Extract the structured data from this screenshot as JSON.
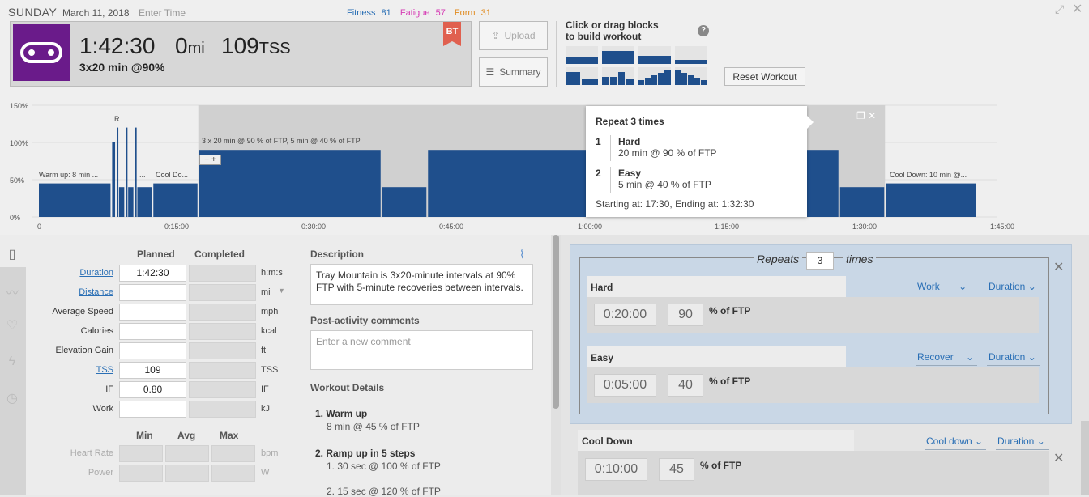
{
  "header": {
    "day": "SUNDAY",
    "date": "March 11, 2018",
    "time_placeholder": "Enter Time",
    "fitness_label": "Fitness",
    "fitness": "81",
    "fatigue_label": "Fatigue",
    "fatigue": "57",
    "form_label": "Form",
    "form": "31"
  },
  "workout": {
    "duration": "1:42:30",
    "distance_num": "0",
    "distance_unit": "mi",
    "tss_num": "109",
    "tss_unit": "TSS",
    "title": "3x20 min @90%",
    "badge": "BT"
  },
  "buttons": {
    "upload": "Upload",
    "summary": "Summary",
    "reset": "Reset Workout"
  },
  "builder": {
    "line1": "Click or drag blocks",
    "line2": "to build workout",
    "help": "?"
  },
  "chart": {
    "y_ticks": [
      "150%",
      "100%",
      "50%",
      "0%"
    ],
    "x_ticks": [
      "0",
      "0:15:00",
      "0:30:00",
      "0:45:00",
      "1:00:00",
      "1:15:00",
      "1:30:00",
      "1:45:00"
    ],
    "labels": {
      "warmup": "Warm up: 8 min ...",
      "ramp": "R...",
      "dots": "...",
      "cooldown1": "Cool Do...",
      "repeat": "3 x 20 min @ 90 % of FTP, 5 min @ 40 % of FTP",
      "cooldown2": "Cool Down: 10 min @..."
    }
  },
  "chart_data": {
    "type": "bar",
    "xlabel": "",
    "ylabel": "",
    "ylim": [
      0,
      150
    ],
    "x_unit": "elapsed time",
    "segments": [
      {
        "start": "0:00:00",
        "end": "0:08:00",
        "pct": 45
      },
      {
        "start": "0:08:00",
        "end": "0:08:30",
        "pct": 100
      },
      {
        "start": "0:08:30",
        "end": "0:08:45",
        "pct": 120
      },
      {
        "start": "0:08:45",
        "end": "0:09:30",
        "pct": 40
      },
      {
        "start": "0:09:30",
        "end": "0:09:45",
        "pct": 120
      },
      {
        "start": "0:09:45",
        "end": "0:10:30",
        "pct": 40
      },
      {
        "start": "0:10:30",
        "end": "0:10:45",
        "pct": 120
      },
      {
        "start": "0:10:45",
        "end": "0:12:30",
        "pct": 40
      },
      {
        "start": "0:12:30",
        "end": "0:17:30",
        "pct": 45
      },
      {
        "start": "0:17:30",
        "end": "0:37:30",
        "pct": 90
      },
      {
        "start": "0:37:30",
        "end": "0:42:30",
        "pct": 40
      },
      {
        "start": "0:42:30",
        "end": "1:02:30",
        "pct": 90
      },
      {
        "start": "1:02:30",
        "end": "1:07:30",
        "pct": 40
      },
      {
        "start": "1:07:30",
        "end": "1:27:30",
        "pct": 90
      },
      {
        "start": "1:27:30",
        "end": "1:32:30",
        "pct": 40
      },
      {
        "start": "1:32:30",
        "end": "1:42:30",
        "pct": 45
      }
    ]
  },
  "popup": {
    "title": "Repeat 3 times",
    "step1_num": "1",
    "step1_name": "Hard",
    "step1_desc": "20 min @ 90 % of FTP",
    "step2_num": "2",
    "step2_name": "Easy",
    "step2_desc": "5 min @ 40 % of FTP",
    "footer": "Starting at: 17:30, Ending at: 1:32:30"
  },
  "stats": {
    "planned": "Planned",
    "completed": "Completed",
    "rows": [
      {
        "label": "Duration",
        "planned": "1:42:30",
        "unit": "h:m:s"
      },
      {
        "label": "Distance",
        "planned": "",
        "unit": "mi"
      },
      {
        "label": "Average Speed",
        "planned": "",
        "unit": "mph"
      },
      {
        "label": "Calories",
        "planned": "",
        "unit": "kcal"
      },
      {
        "label": "Elevation Gain",
        "planned": "",
        "unit": "ft"
      },
      {
        "label": "TSS",
        "planned": "109",
        "unit": "TSS"
      },
      {
        "label": "IF",
        "planned": "0.80",
        "unit": "IF"
      },
      {
        "label": "Work",
        "planned": "",
        "unit": "kJ"
      }
    ],
    "min": "Min",
    "avg": "Avg",
    "max": "Max",
    "hr_label": "Heart Rate",
    "hr_unit": "bpm",
    "power_label": "Power",
    "power_unit": "W"
  },
  "description": {
    "heading": "Description",
    "text": "Tray Mountain is 3x20-minute intervals at 90% FTP with 5-minute recoveries between intervals.",
    "comments_heading": "Post-activity comments",
    "comments_placeholder": "Enter a new comment",
    "details_heading": "Workout Details",
    "step1": "1.  Warm up",
    "step1_sub": "8 min @ 45 % of FTP",
    "step2": "2.  Ramp up in 5 steps",
    "step2_sub1": "1.  30 sec @ 100 % of FTP",
    "step2_sub2": "2.  15 sec @ 120 % of FTP"
  },
  "editor": {
    "repeats_label": "Repeats",
    "repeats": "3",
    "times": "times",
    "hard": {
      "name": "Hard",
      "type": "Work",
      "dur_type": "Duration",
      "time": "0:20:00",
      "pct": "90",
      "unit": "% of FTP"
    },
    "easy": {
      "name": "Easy",
      "type": "Recover",
      "dur_type": "Duration",
      "time": "0:05:00",
      "pct": "40",
      "unit": "% of FTP"
    },
    "cool": {
      "name": "Cool Down",
      "type": "Cool down",
      "dur_type": "Duration",
      "time": "0:10:00",
      "pct": "45",
      "unit": "% of FTP"
    }
  },
  "colors": {
    "bar": "#1f4f8c",
    "accent_link": "#2a6fb5",
    "sport": "#6a1b8a",
    "badge": "#e0604f",
    "fitness": "#2a6fb5",
    "fatigue": "#d63cb4",
    "form": "#e08a1e"
  }
}
